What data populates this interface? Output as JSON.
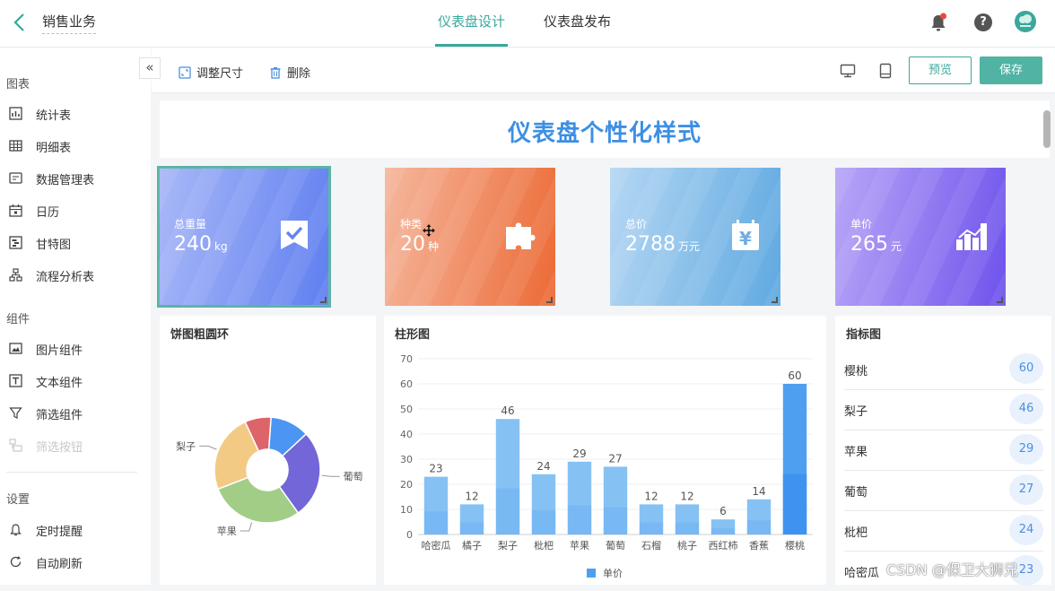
{
  "header": {
    "app_title": "销售业务",
    "tabs": [
      {
        "label": "仪表盘设计",
        "active": true
      },
      {
        "label": "仪表盘发布",
        "active": false
      }
    ],
    "icons": [
      "bell-icon",
      "help-icon",
      "avatar"
    ],
    "help_glyph": "?"
  },
  "sidebar": {
    "sections": [
      {
        "label": "图表",
        "items": [
          {
            "label": "统计表",
            "icon": "stats-table-icon"
          },
          {
            "label": "明细表",
            "icon": "detail-table-icon"
          },
          {
            "label": "数据管理表",
            "icon": "data-manage-icon"
          },
          {
            "label": "日历",
            "icon": "calendar-icon"
          },
          {
            "label": "甘特图",
            "icon": "gantt-icon"
          },
          {
            "label": "流程分析表",
            "icon": "flow-icon"
          }
        ]
      },
      {
        "label": "组件",
        "items": [
          {
            "label": "图片组件",
            "icon": "image-icon"
          },
          {
            "label": "文本组件",
            "icon": "text-icon"
          },
          {
            "label": "筛选组件",
            "icon": "filter-icon"
          },
          {
            "label": "筛选按钮",
            "icon": "filter-button-icon",
            "disabled": true
          }
        ]
      },
      {
        "label": "设置",
        "items": [
          {
            "label": "定时提醒",
            "icon": "bell-outline-icon"
          },
          {
            "label": "自动刷新",
            "icon": "refresh-icon"
          }
        ]
      }
    ],
    "collapse_glyph": "«"
  },
  "toolbar": {
    "resize_label": "调整尺寸",
    "delete_label": "删除",
    "preview_label": "预览",
    "save_label": "保存"
  },
  "dashboard": {
    "title": "仪表盘个性化样式",
    "kpis": [
      {
        "label": "总重量",
        "value": "240",
        "unit": "kg",
        "icon": "check-badge-icon",
        "colors": [
          "#a9b8f7",
          "#5f7ff0"
        ]
      },
      {
        "label": "种类",
        "value": "20",
        "unit": "种",
        "icon": "puzzle-icon",
        "colors": [
          "#f5b79d",
          "#ec6a35"
        ]
      },
      {
        "label": "总价",
        "value": "2788",
        "unit": "万元",
        "icon": "yen-icon",
        "colors": [
          "#b5d7f3",
          "#5fa9e1"
        ]
      },
      {
        "label": "单价",
        "value": "265",
        "unit": "元",
        "icon": "bar-chart-icon",
        "colors": [
          "#b8a6f7",
          "#6f52ec"
        ]
      }
    ],
    "pie_title": "饼图粗圆环",
    "bar_title": "柱形图",
    "index_title": "指标图",
    "index_rows": [
      {
        "name": "樱桃",
        "value": "60"
      },
      {
        "name": "梨子",
        "value": "46"
      },
      {
        "name": "苹果",
        "value": "29"
      },
      {
        "name": "葡萄",
        "value": "27"
      },
      {
        "name": "枇杷",
        "value": "24"
      },
      {
        "name": "哈密瓜",
        "value": "23"
      }
    ]
  },
  "chart_data": [
    {
      "type": "pie",
      "title": "饼图粗圆环",
      "labels": [
        "",
        "葡萄",
        "苹果",
        "梨子",
        ""
      ],
      "values": [
        12,
        27,
        29,
        24,
        8
      ],
      "colors": [
        "#4d95f2",
        "#7266d8",
        "#a2cd87",
        "#f3ca84",
        "#dd6468"
      ]
    },
    {
      "type": "bar",
      "title": "柱形图",
      "categories": [
        "哈密瓜",
        "橘子",
        "梨子",
        "枇杷",
        "苹果",
        "葡萄",
        "石榴",
        "桃子",
        "西红柿",
        "香蕉",
        "樱桃"
      ],
      "series": [
        {
          "name": "单价",
          "values": [
            23,
            12,
            46,
            24,
            29,
            27,
            12,
            12,
            6,
            14,
            60
          ]
        }
      ],
      "ylim": [
        0,
        70
      ],
      "yticks": [
        0,
        10,
        20,
        30,
        40,
        50,
        60,
        70
      ],
      "colors": {
        "light": "#86c1f4",
        "dark": "#4e9ff0",
        "highlight": "#3f93f0"
      }
    }
  ],
  "watermark": "CSDN @保卫大狮兄"
}
